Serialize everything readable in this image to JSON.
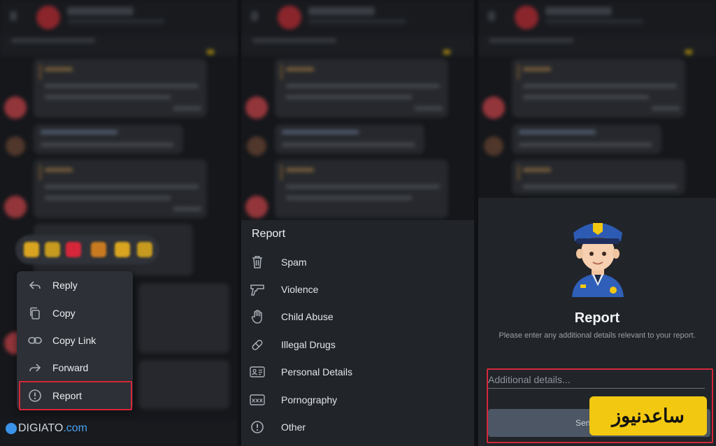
{
  "context_menu": {
    "items": [
      {
        "label": "Reply",
        "icon": "reply-icon"
      },
      {
        "label": "Copy",
        "icon": "copy-icon"
      },
      {
        "label": "Copy Link",
        "icon": "link-icon"
      },
      {
        "label": "Forward",
        "icon": "forward-icon"
      },
      {
        "label": "Report",
        "icon": "report-icon"
      }
    ],
    "highlighted": "Report"
  },
  "report_sheet": {
    "title": "Report",
    "options": [
      {
        "label": "Spam",
        "icon": "trash-icon"
      },
      {
        "label": "Violence",
        "icon": "gun-icon"
      },
      {
        "label": "Child Abuse",
        "icon": "hand-icon"
      },
      {
        "label": "Illegal Drugs",
        "icon": "pill-icon"
      },
      {
        "label": "Personal Details",
        "icon": "id-card-icon"
      },
      {
        "label": "Pornography",
        "icon": "xxx-icon"
      },
      {
        "label": "Other",
        "icon": "info-icon"
      }
    ]
  },
  "report_dialog": {
    "title": "Report",
    "description": "Please enter any additional details relevant to your report.",
    "input_placeholder": "Additional details...",
    "send_label": "Sen",
    "illustration": "police-officer-icon"
  },
  "watermarks": {
    "left": "DIGIATO",
    "left_domain": ".com",
    "right": "ساعدنیوز"
  },
  "colors": {
    "highlight": "#d6273a",
    "background": "#1c1f24",
    "sheet": "#212429",
    "button": "#4c5664",
    "stamp": "#f2c811"
  }
}
